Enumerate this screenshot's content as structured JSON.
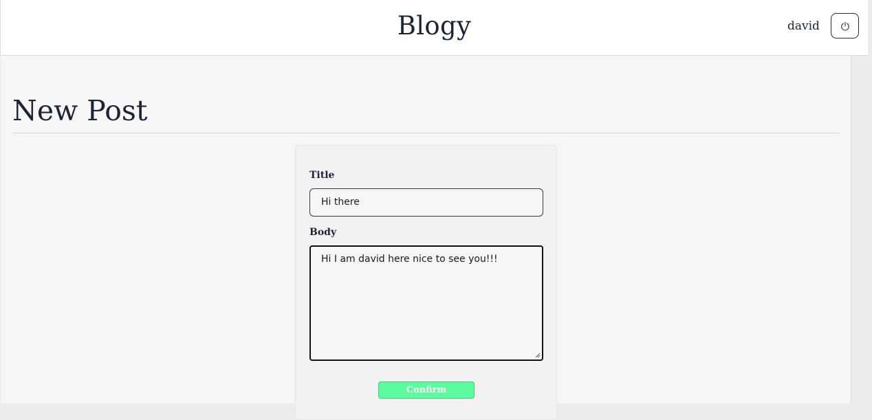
{
  "header": {
    "brand": "Blogy",
    "username": "david",
    "logout_icon": "power-icon"
  },
  "page": {
    "title": "New Post"
  },
  "form": {
    "title_label": "Title",
    "title_value": "Hi there",
    "body_label": "Body",
    "body_value": "Hi I am david here nice to see you!!!",
    "confirm_label": "Confirm"
  },
  "colors": {
    "confirm_bg": "#5dfb9e",
    "text": "#1f2433",
    "main_bg": "#f6f6f6"
  }
}
